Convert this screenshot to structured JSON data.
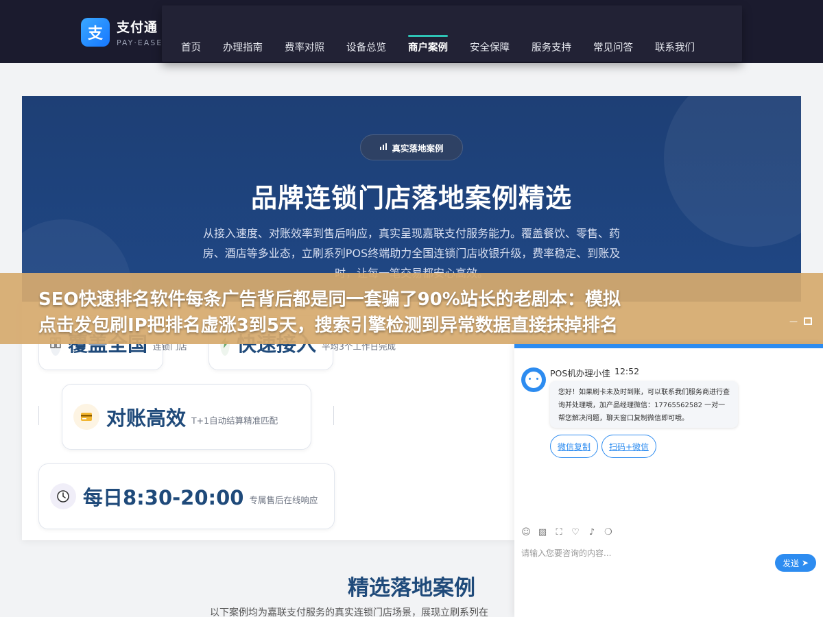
{
  "header": {
    "logo_mark": "支",
    "logo_cn": "支付通",
    "logo_en": "PAY·EASE",
    "nav": [
      "首页",
      "办理指南",
      "费率对照",
      "设备总览",
      "商户案例",
      "安全保障",
      "服务支持",
      "常见问答",
      "联系我们"
    ],
    "active_nav": "商户案例"
  },
  "hero": {
    "badge_icon": "bar-chart-icon",
    "badge": "真实落地案例",
    "title": "品牌连锁门店落地案例精选",
    "description": "从接入速度、对账效率到售后响应，真实呈现嘉联支付服务能力。覆盖餐饮、零售、药房、酒店等多业态，立刷系列POS终端助力全国连锁门店收银升级，费率稳定、到账及时，让每一笔交易都安心高效。"
  },
  "features": [
    {
      "icon": "grid-icon",
      "big": "覆盖全国",
      "small": "连锁门店"
    },
    {
      "icon": "lightning-icon",
      "big": "快速接入",
      "small": "平均3个工作日完成"
    },
    {
      "icon": "card-icon",
      "big": "对账高效",
      "small": "T+1自动结算精准匹配"
    },
    {
      "icon": "clock-icon",
      "big": "每日8:30-20:00",
      "small": "专属售后在线响应"
    }
  ],
  "section": {
    "title": "精选落地案例",
    "description": "以下案例均为嘉联支付服务的真实连锁门店场景，展现立刷系列在"
  },
  "banner": {
    "line1": "SEO快速排名软件每条广告背后都是同一套骗了90%站长的老剧本：模拟",
    "line2": "点击发包刷IP把排名虚涨3到5天，搜索引擎检测到异常数据直接抹掉排名"
  },
  "chat": {
    "agent_name": "POS机办理小佳",
    "time": "12:52",
    "message": "您好！如果刷卡未及时到账，可以联系我们服务商进行查询并处理哦，加产品经理微信：17765562582 一对一帮您解决问题，聊天窗口复制微信即可哦。",
    "buttons": [
      "微信复制",
      "扫码+微信"
    ],
    "input_placeholder": "请输入您要咨询的内容...",
    "send_label": "发送",
    "accent": "#2d8cf0"
  }
}
